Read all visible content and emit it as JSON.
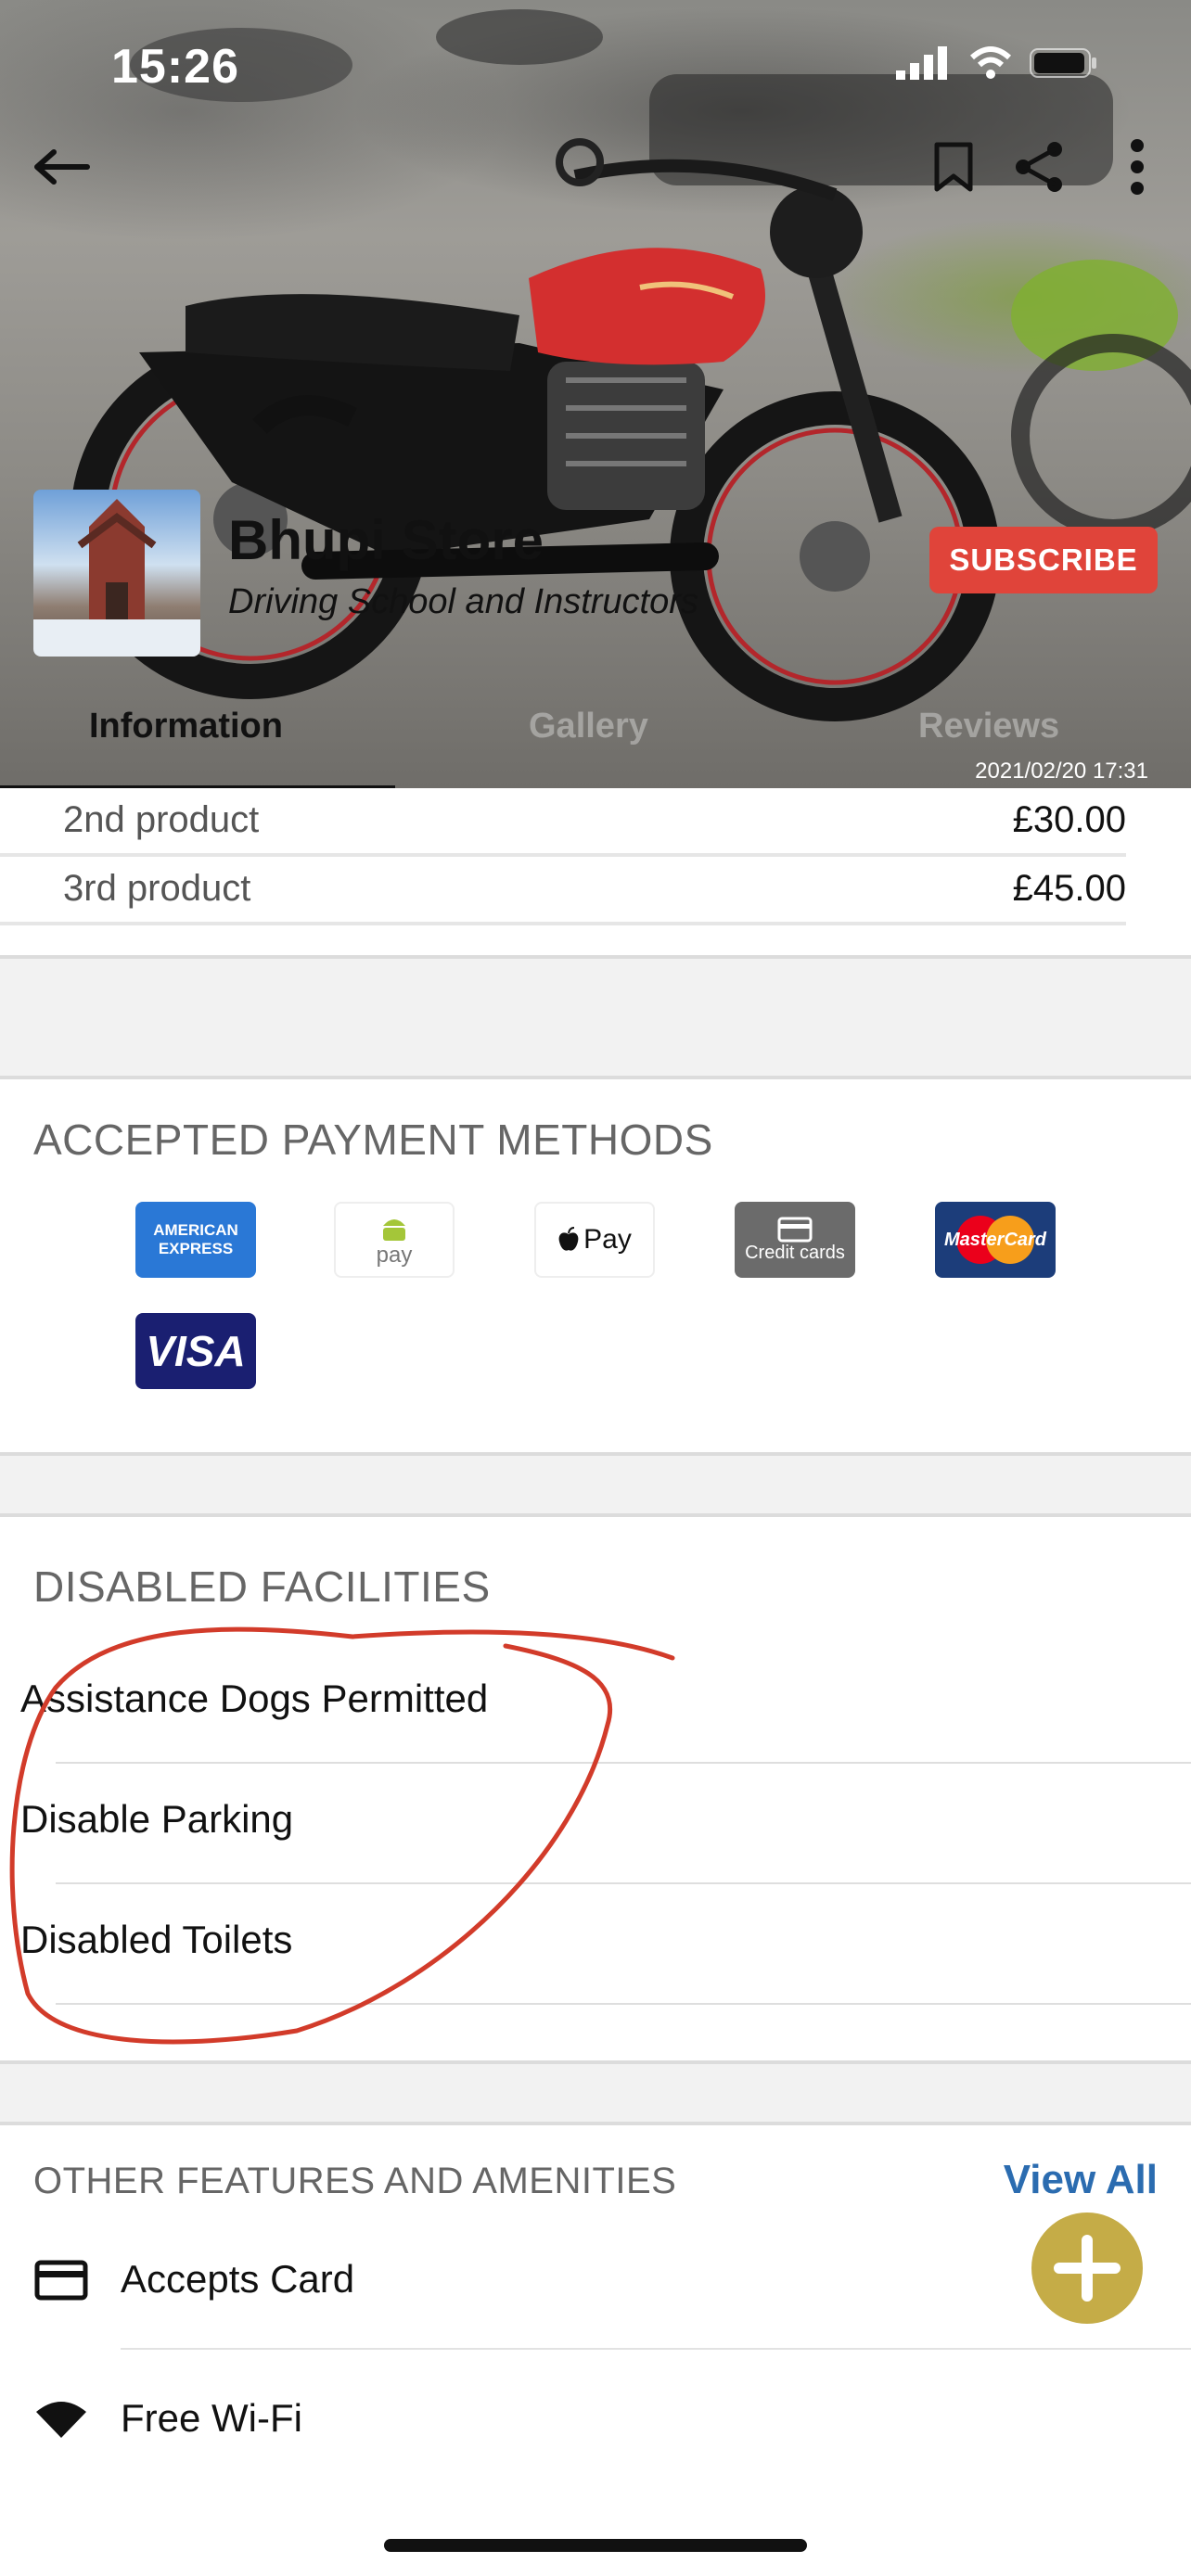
{
  "status_bar": {
    "time": "15:26"
  },
  "hero": {
    "store_name": "Bhupi Store",
    "category": "Driving School and Instructors",
    "subscribe_label": "SUBSCRIBE",
    "photo_date": "2021/02/20 17:31",
    "tabs": [
      {
        "label": "Information",
        "active": true
      },
      {
        "label": "Gallery",
        "active": false
      },
      {
        "label": "Reviews",
        "active": false
      }
    ]
  },
  "products": [
    {
      "name": "2nd product",
      "price": "£30.00"
    },
    {
      "name": "3rd product",
      "price": "£45.00"
    }
  ],
  "payment": {
    "title": "ACCEPTED PAYMENT METHODS",
    "methods": [
      {
        "name": "amex",
        "line1": "AMERICAN",
        "line2": "EXPRESS",
        "color": "#2a78d6"
      },
      {
        "name": "android-pay",
        "label": "pay",
        "color": "#a4c639"
      },
      {
        "name": "apple-pay",
        "label": "Pay"
      },
      {
        "name": "credit-cards",
        "label": "Credit cards",
        "color": "#6b6b6b"
      },
      {
        "name": "mastercard",
        "label": "MasterCard",
        "color": "#1c3d7a"
      },
      {
        "name": "visa",
        "label": "VISA",
        "color": "#1a1f71"
      }
    ]
  },
  "disabled": {
    "title": "DISABLED FACILITIES",
    "items": [
      "Assistance Dogs Permitted",
      "Disable Parking",
      "Disabled Toilets"
    ],
    "annotation_color": "#d23b2a"
  },
  "other": {
    "title": "OTHER FEATURES AND AMENITIES",
    "view_all": "View All",
    "items": [
      {
        "label": "Accepts Card",
        "icon": "credit-card-icon"
      },
      {
        "label": "Free Wi-Fi",
        "icon": "wifi-icon"
      }
    ]
  },
  "colors": {
    "accent_blue": "#2b6cb0",
    "subscribe_red": "#e0443a",
    "fab_gold": "#c5ac47"
  }
}
